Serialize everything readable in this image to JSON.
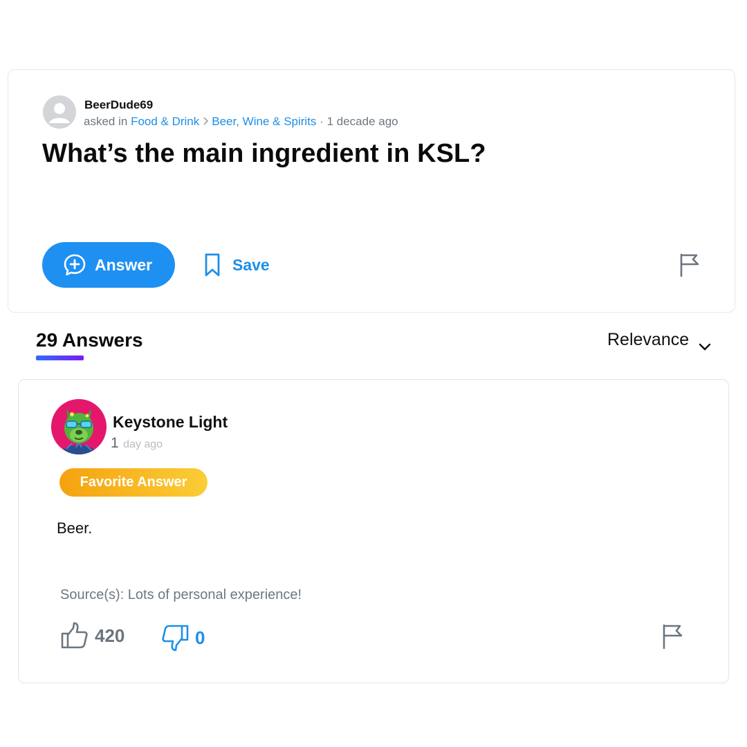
{
  "question": {
    "author": "BeerDude69",
    "asked_prefix": "asked in",
    "category": "Food & Drink",
    "subcategory": "Beer, Wine & Spirits",
    "separator": "·",
    "time": "1 decade ago",
    "title": "What’s the main ingredient in KSL?",
    "answer_label": "Answer",
    "save_label": "Save",
    "icons": {
      "avatar": "default-user-avatar",
      "answer": "add-comment-icon",
      "save": "bookmark-icon",
      "flag": "flag-icon"
    }
  },
  "answers_header": {
    "count_label": "29 Answers",
    "sort_label": "Relevance",
    "sort_icon": "chevron-down-icon"
  },
  "answer": {
    "author": "Keystone Light",
    "time_number": "1",
    "time_rest": "day ago",
    "badge": "Favorite Answer",
    "body": "Beer.",
    "source": "Source(s): Lots of personal experience!",
    "upvotes": "420",
    "downvotes": "0",
    "icons": {
      "avatar": "green-bulldog-sunglasses-avatar",
      "upvote": "thumbs-up-icon",
      "downvote": "thumbs-down-icon",
      "flag": "flag-icon"
    }
  },
  "colors": {
    "link_blue": "#1d8fe8",
    "answer_button": "#1e90f2",
    "badge_start": "#f5a20f",
    "badge_end": "#fbcd37",
    "underline_start": "#2e6bff",
    "underline_end": "#7a1cf2",
    "avatar_bg": "#e5176d"
  }
}
